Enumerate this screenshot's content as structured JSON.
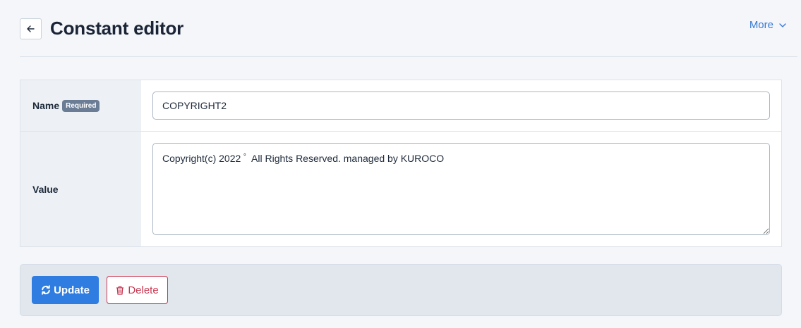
{
  "header": {
    "title": "Constant editor",
    "more_label": "More"
  },
  "form": {
    "name": {
      "label": "Name",
      "required_badge": "Required",
      "value": "COPYRIGHT2"
    },
    "value": {
      "label": "Value",
      "text": "Copyright(c) 2022 ﾟ All Rights Reserved. managed by KUROCO"
    }
  },
  "actions": {
    "update_label": "Update",
    "delete_label": "Delete"
  },
  "colors": {
    "primary": "#2f7de1",
    "danger": "#c8354f",
    "link": "#3a7bd5",
    "badge": "#6b7d95"
  }
}
